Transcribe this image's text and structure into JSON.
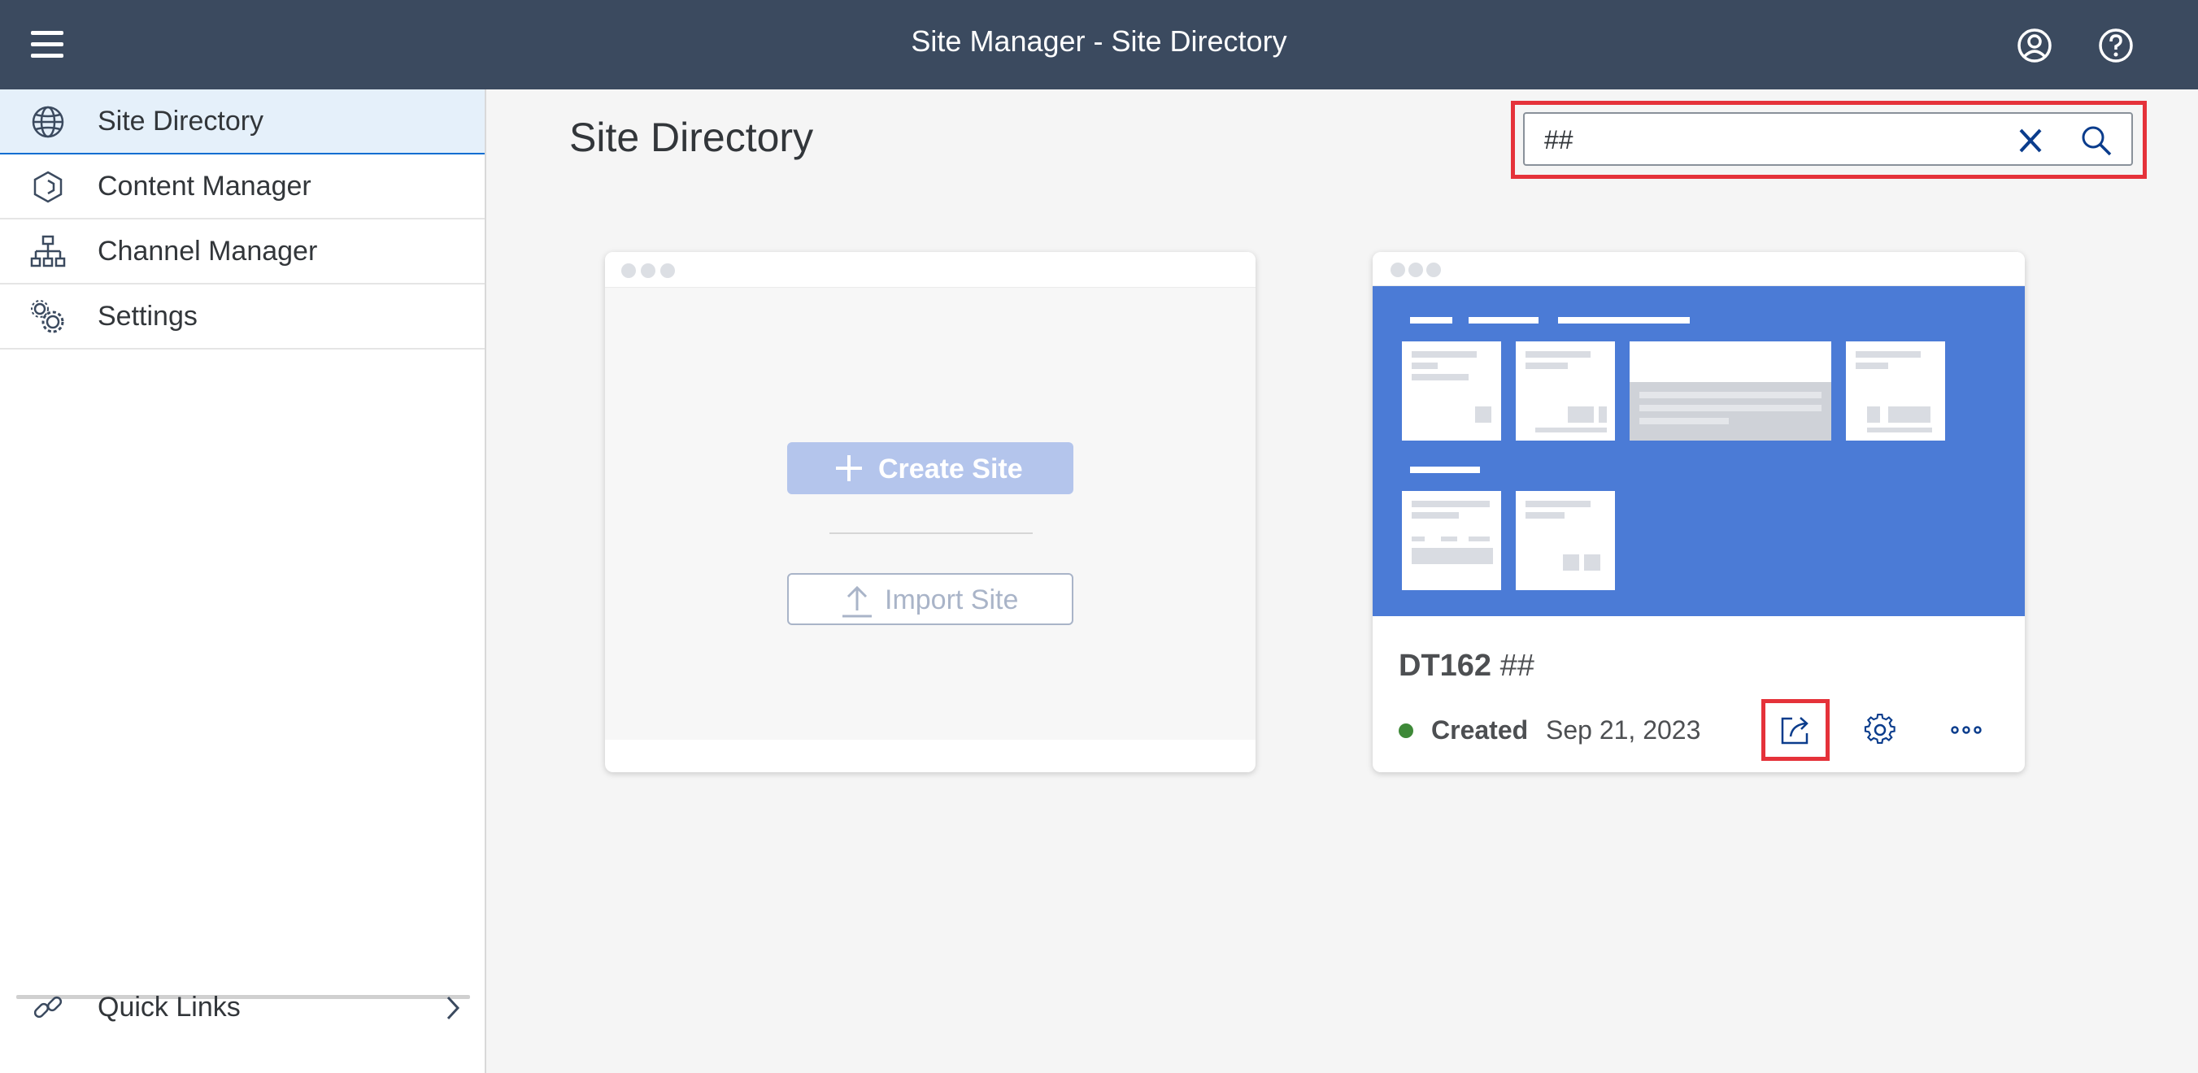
{
  "header": {
    "title": "Site Manager - Site Directory",
    "menu_icon": "hamburger-icon",
    "user_icon": "user-profile-icon",
    "help_icon": "help-icon"
  },
  "sidebar": {
    "items": [
      {
        "label": "Site Directory",
        "icon": "globe-icon",
        "selected": true
      },
      {
        "label": "Content Manager",
        "icon": "cube-icon",
        "selected": false
      },
      {
        "label": "Channel Manager",
        "icon": "org-chart-icon",
        "selected": false
      },
      {
        "label": "Settings",
        "icon": "gears-icon",
        "selected": false
      }
    ],
    "quick_links": {
      "label": "Quick Links",
      "icon": "link-icon",
      "chevron": "chevron-right-icon"
    }
  },
  "main": {
    "title": "Site Directory",
    "search": {
      "value": "##",
      "placeholder": "",
      "clear_icon": "clear-icon",
      "search_icon": "search-icon"
    },
    "create_card": {
      "create_label": "Create Site",
      "import_label": "Import Site"
    },
    "site_card": {
      "name": "DT162",
      "name_suffix": "##",
      "status": "Created",
      "date": "Sep 21, 2023",
      "status_color": "#3e8938",
      "actions": [
        "open-site-icon",
        "settings-gear-icon",
        "more-options-icon"
      ]
    }
  },
  "colors": {
    "shell": "#3b4a5f",
    "accent": "#0a6ed1",
    "preview": "#4b7bd6",
    "highlight": "#e5323a"
  }
}
